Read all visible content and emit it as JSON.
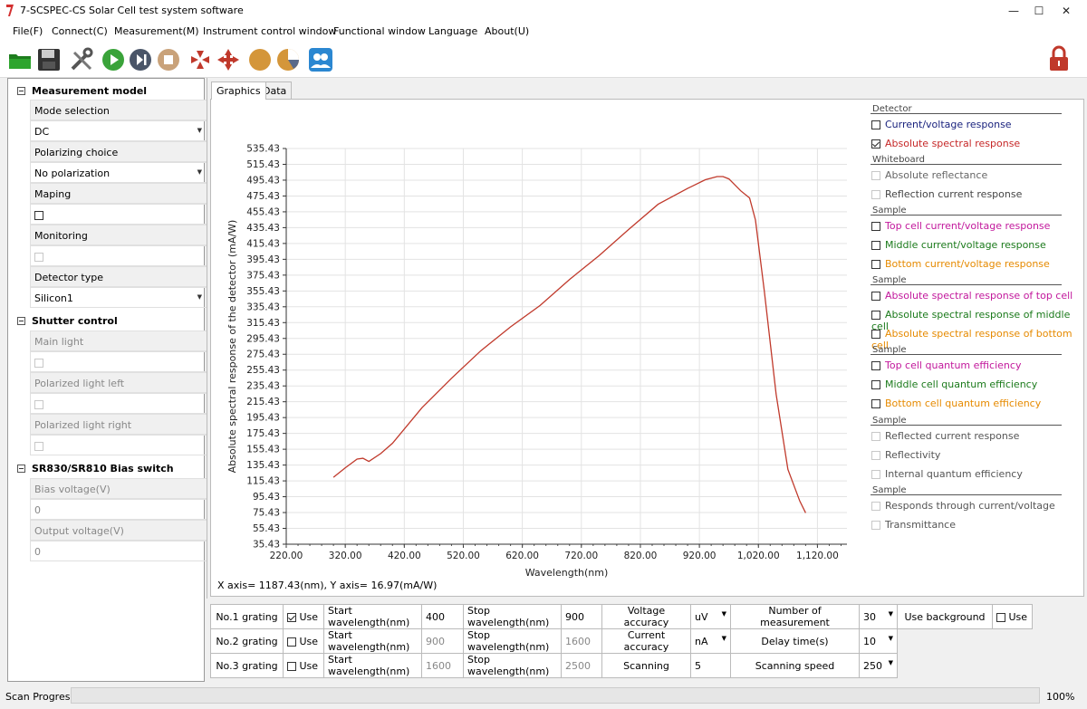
{
  "window": {
    "title": "7-SCSPEC-CS Solar Cell test system software",
    "minimize": "—",
    "maximize": "☐",
    "close": "✕"
  },
  "menu": [
    "File(F)",
    "Connect(C)",
    "Measurement(M)",
    "Instrument control window",
    "Functional window",
    "Language",
    "About(U)"
  ],
  "toolbar": [
    "open-folder-icon",
    "save-icon",
    "tools-icon",
    "play-icon",
    "step-icon",
    "stop-icon",
    "move-in-icon",
    "move-out-icon",
    "circle-icon",
    "pie-icon",
    "users-icon",
    "lock-icon"
  ],
  "left": {
    "measurement_model": "Measurement model",
    "mode_selection": "Mode selection",
    "mode_value": "DC",
    "polarizing_choice": "Polarizing choice",
    "polarizing_value": "No polarization",
    "maping": "Maping",
    "monitoring": "Monitoring",
    "detector_type": "Detector type",
    "detector_value": "Silicon1",
    "shutter_control": "Shutter control",
    "main_light": "Main light",
    "pol_left": "Polarized light left",
    "pol_right": "Polarized light right",
    "bias_switch": "SR830/SR810 Bias switch",
    "bias_voltage": "Bias voltage(V)",
    "bias_voltage_value": "0",
    "output_voltage": "Output voltage(V)",
    "output_voltage_value": "0"
  },
  "tabs": [
    "Graphics",
    "Data"
  ],
  "chart_data": {
    "type": "line",
    "xlabel": "Wavelength(nm)",
    "ylabel": "Absolute spectral response of the detector (mA/W)",
    "xlim": [
      220,
      1170
    ],
    "ylim": [
      35.43,
      535.43
    ],
    "x_ticks": [
      "220.00",
      "320.00",
      "420.00",
      "520.00",
      "620.00",
      "720.00",
      "820.00",
      "920.00",
      "1,020.00",
      "1,120.00"
    ],
    "y_ticks": [
      "35.43",
      "55.43",
      "75.43",
      "95.43",
      "115.43",
      "135.43",
      "155.43",
      "175.43",
      "195.43",
      "215.43",
      "235.43",
      "255.43",
      "275.43",
      "295.43",
      "315.43",
      "335.43",
      "355.43",
      "375.43",
      "395.43",
      "415.43",
      "435.43",
      "455.43",
      "475.43",
      "495.43",
      "515.43",
      "535.43"
    ],
    "series": [
      {
        "color": "#c0392b",
        "x": [
          300,
          320,
          340,
          350,
          360,
          380,
          400,
          450,
          500,
          550,
          600,
          650,
          700,
          750,
          800,
          850,
          900,
          930,
          950,
          960,
          970,
          990,
          1005,
          1015,
          1030,
          1050,
          1070,
          1090,
          1100
        ],
        "y": [
          120,
          132,
          143,
          144,
          140,
          150,
          163,
          208,
          245,
          280,
          310,
          337,
          370,
          400,
          433,
          465,
          485,
          496,
          500,
          500,
          497,
          482,
          473,
          445,
          355,
          225,
          130,
          90,
          75
        ]
      }
    ],
    "grid": true
  },
  "coords": "X axis= 1187.43(nm), Y axis= 16.97(mA/W)",
  "right": {
    "detector": "Detector",
    "cur_volt": "Current/voltage response",
    "abs_spec": "Absolute spectral response",
    "whiteboard": "Whiteboard",
    "abs_refl": "Absolute reflectance",
    "refl_cur": "Reflection current response",
    "sample1": "Sample",
    "top_cur": "Top cell current/voltage response",
    "mid_cur": "Middle current/voltage response",
    "bot_cur": "Bottom current/voltage response",
    "sample2": "Sample",
    "abs_top": "Absolute spectral response of top cell",
    "abs_mid": "Absolute spectral response of middle cell",
    "abs_bot": "Absolute spectral response of bottom cell",
    "sample3": "Sample",
    "top_qe": "Top cell quantum efficiency",
    "mid_qe": "Middle cell quantum efficiency",
    "bot_qe": "Bottom cell quantum efficiency",
    "sample4": "Sample",
    "refl_cur_resp": "Reflected current response",
    "reflectivity": "Reflectivity",
    "iqe": "Internal quantum efficiency",
    "sample5": "Sample",
    "through": "Responds through current/voltage",
    "transmittance": "Transmittance"
  },
  "bottom": {
    "g1": "No.1 grating",
    "g2": "No.2 grating",
    "g3": "No.3 grating",
    "use": "Use",
    "start": "Start wavelength(nm)",
    "stop": "Stop wavelength(nm)",
    "s1": "400",
    "s2": "900",
    "s3": "1600",
    "e1": "900",
    "e2": "1600",
    "e3": "2500",
    "volt_acc": "Voltage accuracy",
    "volt_unit": "uV",
    "cur_acc": "Current accuracy",
    "cur_unit": "nA",
    "scanning": "Scanning",
    "scanning_val": "5",
    "num_meas": "Number of measurement",
    "num_val": "30",
    "delay": "Delay time(s)",
    "delay_val": "10",
    "speed": "Scanning speed",
    "speed_val": "250",
    "use_bg": "Use background"
  },
  "status": {
    "label": "Scan Progress:",
    "percent": "100%",
    "progress": 1.0
  }
}
